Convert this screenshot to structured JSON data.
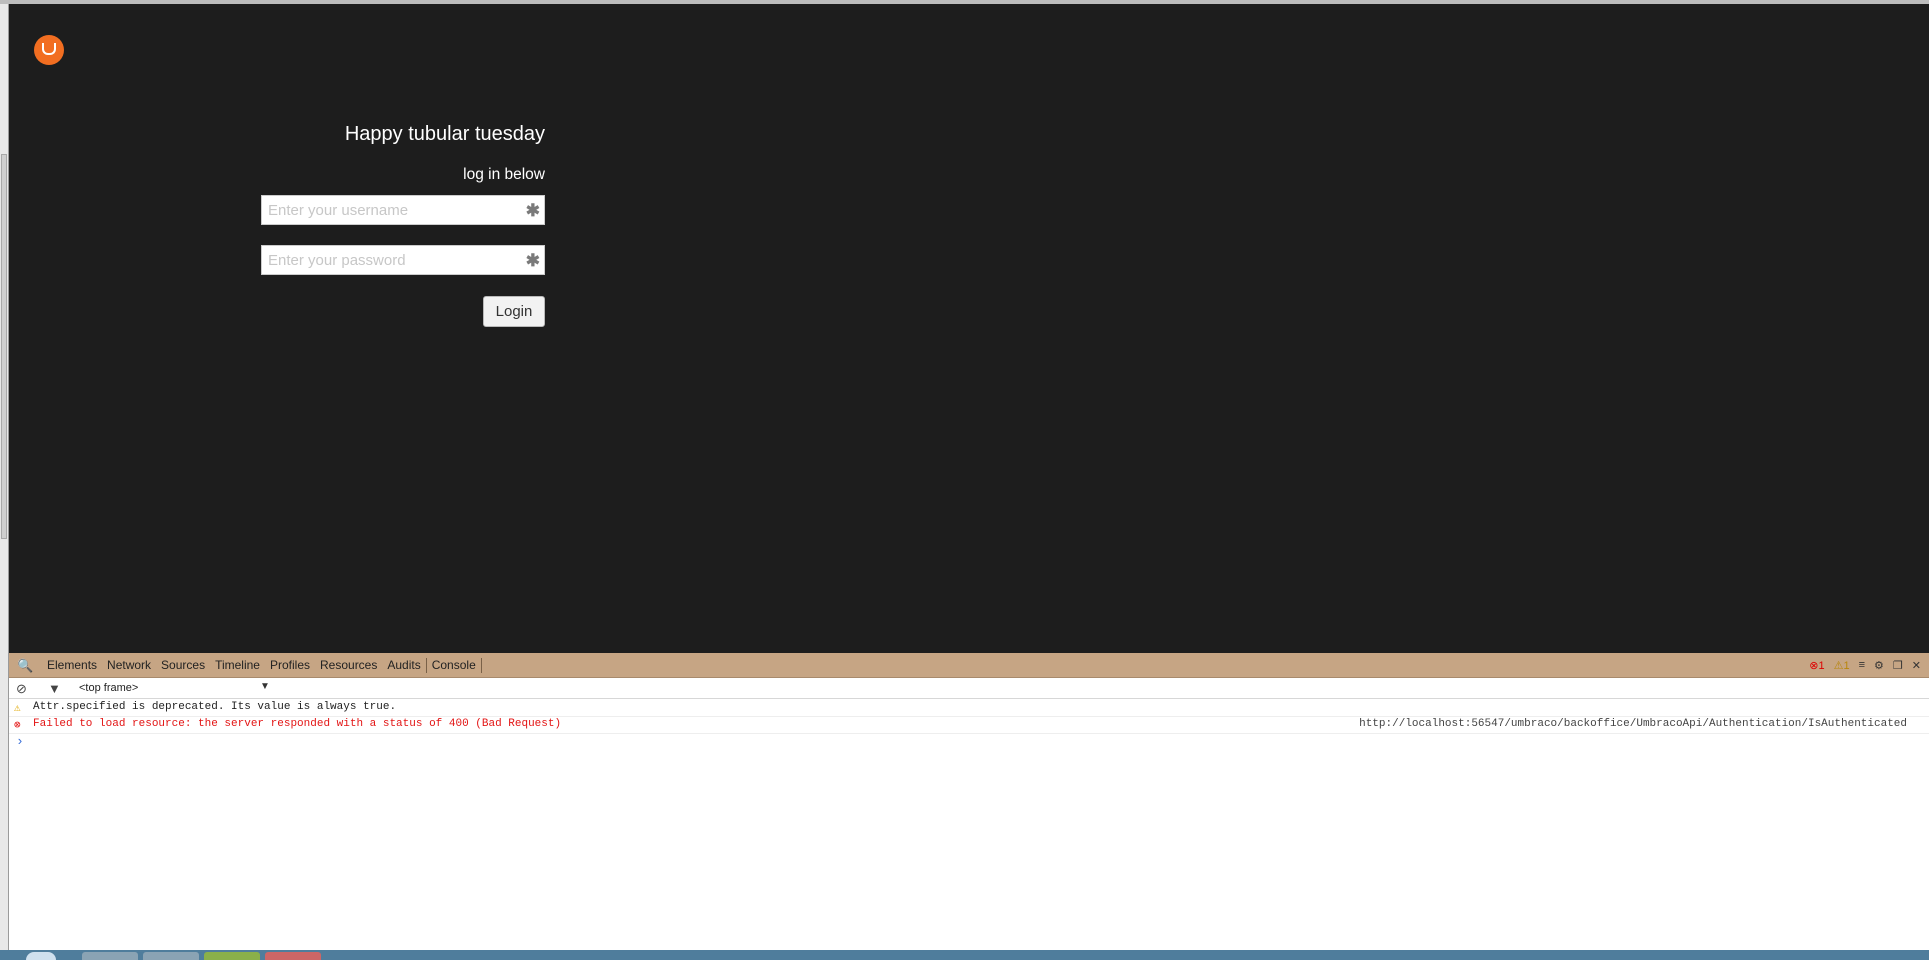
{
  "login": {
    "greeting": "Happy tubular tuesday",
    "subtitle": "log in below",
    "username_placeholder": "Enter your username",
    "password_placeholder": "Enter your password",
    "required_marker": "✱",
    "login_label": "Login",
    "logo_icon": "umbraco-logo-icon",
    "accent_color": "#f26e21"
  },
  "devtools": {
    "tabs": [
      "Elements",
      "Network",
      "Sources",
      "Timeline",
      "Profiles",
      "Resources",
      "Audits",
      "Console"
    ],
    "active_tab": "Console",
    "error_count": "1",
    "warning_count": "1",
    "frame": "<top frame>",
    "messages": [
      {
        "level": "warning",
        "text": "Attr.specified is deprecated. Its value is always true.",
        "source": ""
      },
      {
        "level": "error",
        "text": "Failed to load resource: the server responded with a status of 400 (Bad Request)",
        "source": "http://localhost:56547/umbraco/backoffice/UmbracoApi/Authentication/IsAuthenticated"
      }
    ],
    "toolbar_color": "#c6a584"
  }
}
